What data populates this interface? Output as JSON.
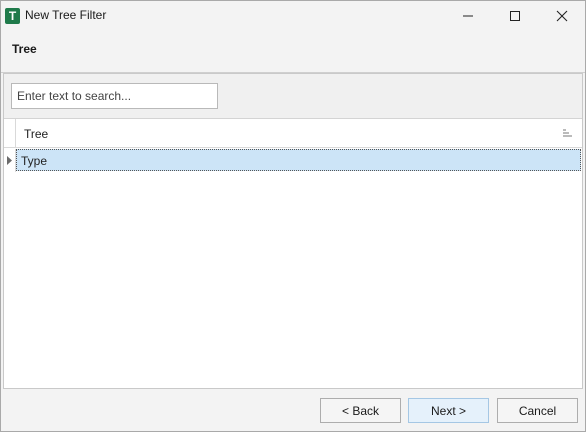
{
  "window": {
    "title": "New Tree Filter",
    "app_icon_letter": "T"
  },
  "header": {
    "title": "Tree"
  },
  "search": {
    "placeholder": "Enter text to search..."
  },
  "tree": {
    "column_header": "Tree",
    "rows": [
      {
        "label": "Type",
        "selected": true,
        "expandable": true
      }
    ]
  },
  "footer": {
    "back_label": "< Back",
    "next_label": "Next >",
    "cancel_label": "Cancel"
  },
  "colors": {
    "app_icon": "#1f7a4a",
    "selected_row": "#cce4f7",
    "default_button": "#e5f1fb"
  },
  "icons": {
    "app": "app-logo-icon",
    "minimize": "minimize-icon",
    "maximize": "maximize-icon",
    "close": "close-icon",
    "expander": "expand-triangle-icon",
    "sort": "sort-icon"
  }
}
